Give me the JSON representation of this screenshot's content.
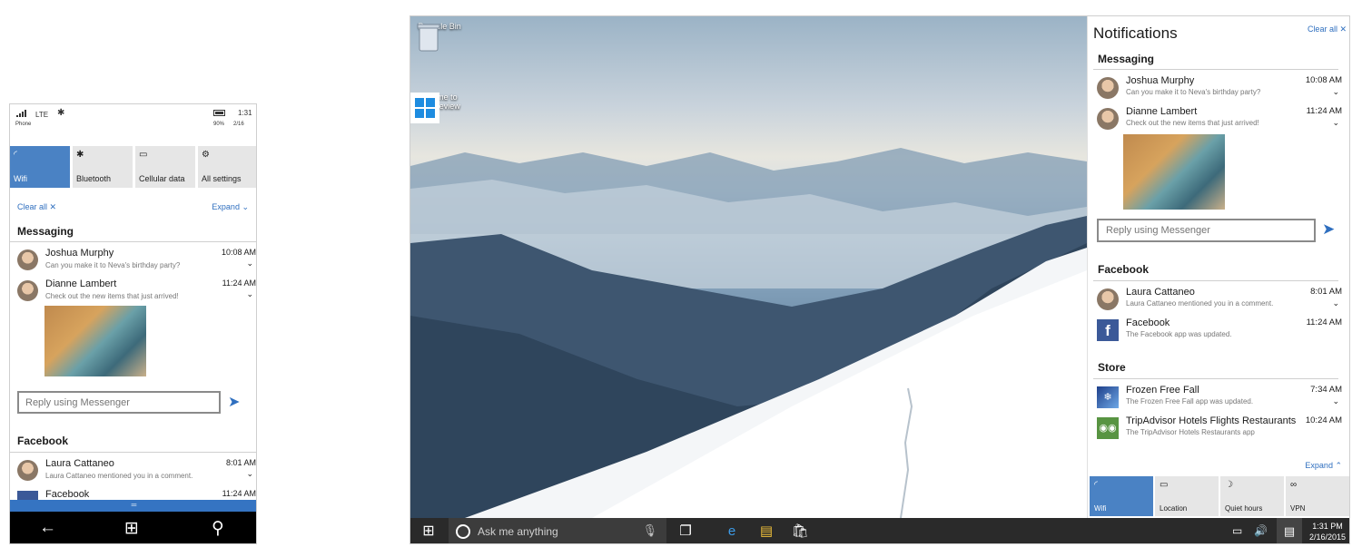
{
  "phone": {
    "status": {
      "carrier": "Phone",
      "network": "LTE",
      "battery": "90%",
      "time": "1:31",
      "date": "2/16"
    },
    "quick_actions": [
      {
        "label": "Wifi",
        "icon": "wifi-icon",
        "active": true
      },
      {
        "label": "Bluetooth",
        "icon": "bluetooth-icon",
        "active": false
      },
      {
        "label": "Cellular data",
        "icon": "cellular-data-icon",
        "active": false
      },
      {
        "label": "All settings",
        "icon": "gear-icon",
        "active": false
      }
    ],
    "clear_all": "Clear all ✕",
    "expand": "Expand ⌄",
    "sections": {
      "messaging": "Messaging",
      "facebook": "Facebook"
    },
    "notifications": [
      {
        "name": "Joshua Murphy",
        "message": "Can you make it to Neva's birthday party?",
        "time": "10:08 AM"
      },
      {
        "name": "Dianne Lambert",
        "message": "Check out the new items that just arrived!",
        "time": "11:24 AM"
      },
      {
        "name": "Laura Cattaneo",
        "message": "Laura Cattaneo mentioned you in a comment.",
        "time": "8:01 AM"
      },
      {
        "name": "Facebook",
        "message": "",
        "time": "11:24 AM"
      }
    ],
    "reply_placeholder": "Reply using Messenger"
  },
  "desktop": {
    "icons": [
      {
        "label": "Recycle Bin",
        "icon": "recycle-bin-icon"
      },
      {
        "label": "Welcome to Tech Preview",
        "icon": "windows-logo-icon"
      }
    ],
    "taskbar": {
      "search_placeholder": "Ask me anything",
      "clock_time": "1:31 PM",
      "clock_date": "2/16/2015",
      "apps": [
        "task-view-icon",
        "internet-explorer-icon",
        "file-explorer-icon",
        "store-icon"
      ]
    },
    "action_center": {
      "title": "Notifications",
      "clear_all": "Clear all ✕",
      "sections": {
        "messaging": "Messaging",
        "facebook": "Facebook",
        "store": "Store"
      },
      "messaging": [
        {
          "name": "Joshua Murphy",
          "message": "Can you make it to Neva's birthday party?",
          "time": "10:08 AM"
        },
        {
          "name": "Dianne Lambert",
          "message": "Check out the new items that just arrived!",
          "time": "11:24 AM"
        }
      ],
      "reply_placeholder": "Reply using Messenger",
      "facebook": [
        {
          "name": "Laura Cattaneo",
          "message": "Laura Cattaneo mentioned you in a comment.",
          "time": "8:01 AM"
        },
        {
          "name": "Facebook",
          "message": "The Facebook app was updated.",
          "time": "11:24 AM"
        }
      ],
      "store": [
        {
          "name": "Frozen Free Fall",
          "message": "The Frozen Free Fall app was updated.",
          "time": "7:34 AM"
        },
        {
          "name": "TripAdvisor Hotels Flights Restaurants",
          "message": "The TripAdvisor Hotels Restaurants app",
          "time": "10:24 AM"
        }
      ],
      "expand": "Expand ⌃",
      "quick_actions": [
        {
          "label": "Wifi",
          "icon": "wifi-icon",
          "active": true
        },
        {
          "label": "Location",
          "icon": "location-icon",
          "active": false
        },
        {
          "label": "Quiet hours",
          "icon": "moon-icon",
          "active": false
        },
        {
          "label": "VPN",
          "icon": "vpn-icon",
          "active": false
        }
      ]
    }
  },
  "colors": {
    "accent": "#4a82c4",
    "link": "#2f6fbf",
    "taskbar": "#2a2a2a"
  }
}
